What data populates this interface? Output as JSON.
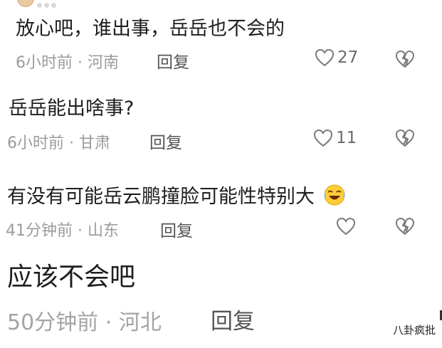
{
  "comments": [
    {
      "text": "放心吧，谁出事，岳岳也不会的",
      "time": "6小时前",
      "sep": "·",
      "region": "河南",
      "reply": "回复",
      "likes": "27"
    },
    {
      "text": "岳岳能出啥事?",
      "time": "6小时前",
      "sep": "·",
      "region": "甘肃",
      "reply": "回复",
      "likes": "11"
    },
    {
      "text": "有没有可能岳云鹏撞脸可能性特别大",
      "time": "41分钟前",
      "sep": "·",
      "region": "山东",
      "reply": "回复",
      "likes": ""
    },
    {
      "text": "应该不会吧",
      "time": "50分钟前",
      "sep": "·",
      "region": "河北",
      "reply": "回复"
    }
  ],
  "watermark": "八卦疯批",
  "icons": {
    "like": "heart-outline-icon",
    "dislike": "broken-heart-icon",
    "emoji": "laughing-crying-emoji-icon"
  }
}
